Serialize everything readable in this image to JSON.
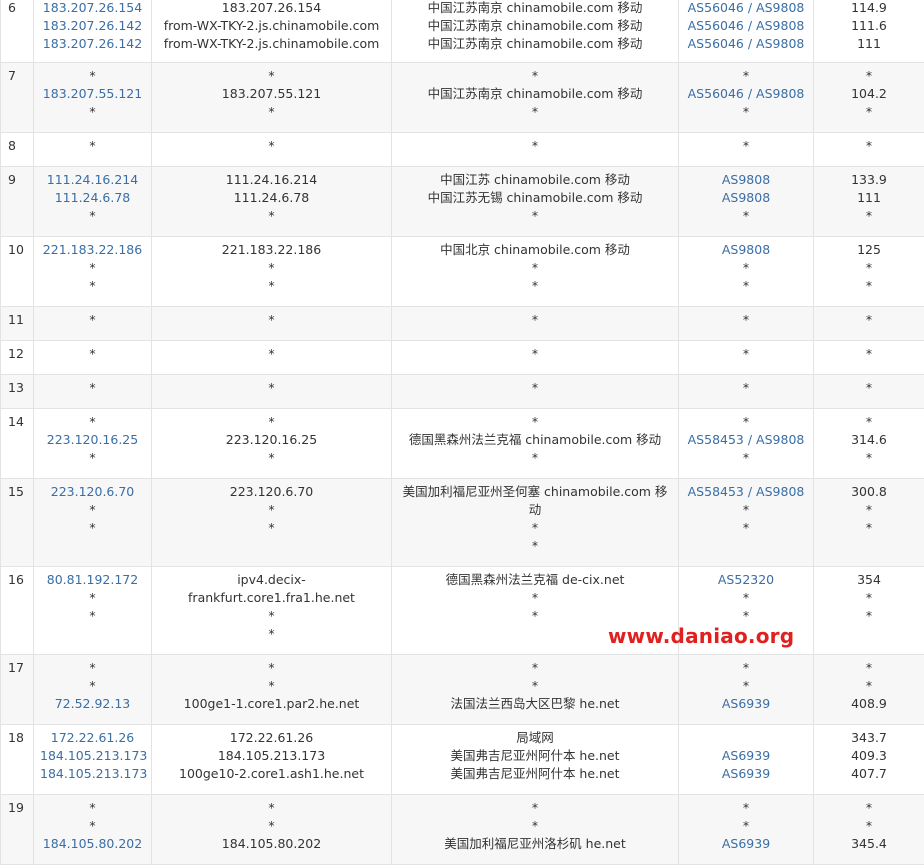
{
  "rows": [
    {
      "hop": "6",
      "h": 68,
      "ip": [
        "183.207.26.154",
        "183.207.26.142",
        "183.207.26.142"
      ],
      "host": [
        "183.207.26.154",
        "from-WX-TKY-2.js.chinamobile.com",
        "from-WX-TKY-2.js.chinamobile.com"
      ],
      "loc": [
        "中国江苏南京 chinamobile.com 移动",
        "中国江苏南京 chinamobile.com 移动",
        "中国江苏南京 chinamobile.com 移动"
      ],
      "asn": [
        "AS56046 / AS9808",
        "AS56046 / AS9808",
        "AS56046 / AS9808"
      ],
      "rtt": [
        "114.9",
        "111.6",
        "111"
      ]
    },
    {
      "hop": "7",
      "h": 70,
      "ip": [
        "*",
        "183.207.55.121",
        "*"
      ],
      "host": [
        "*",
        "183.207.55.121",
        "*"
      ],
      "loc": [
        "*",
        "中国江苏南京 chinamobile.com 移动",
        "*"
      ],
      "asn": [
        "*",
        "AS56046 / AS9808",
        "*"
      ],
      "rtt": [
        "*",
        "104.2",
        "*"
      ]
    },
    {
      "hop": "8",
      "h": 34,
      "ip": [
        "*"
      ],
      "host": [
        "*"
      ],
      "loc": [
        "*"
      ],
      "asn": [
        "*"
      ],
      "rtt": [
        "*"
      ]
    },
    {
      "hop": "9",
      "h": 70,
      "ip": [
        "111.24.16.214",
        "111.24.6.78",
        "*"
      ],
      "host": [
        "111.24.16.214",
        "111.24.6.78",
        "*"
      ],
      "loc": [
        "中国江苏 chinamobile.com 移动",
        "中国江苏无锡 chinamobile.com 移动",
        "*"
      ],
      "asn": [
        "AS9808",
        "AS9808",
        "*"
      ],
      "rtt": [
        "133.9",
        "111",
        "*"
      ]
    },
    {
      "hop": "10",
      "h": 70,
      "ip": [
        "221.183.22.186",
        "*",
        "*"
      ],
      "host": [
        "221.183.22.186",
        "*",
        "*"
      ],
      "loc": [
        "中国北京 chinamobile.com 移动",
        "*",
        "*"
      ],
      "asn": [
        "AS9808",
        "*",
        "*"
      ],
      "rtt": [
        "125",
        "*",
        "*"
      ]
    },
    {
      "hop": "11",
      "h": 34,
      "ip": [
        "*"
      ],
      "host": [
        "*"
      ],
      "loc": [
        "*"
      ],
      "asn": [
        "*"
      ],
      "rtt": [
        "*"
      ]
    },
    {
      "hop": "12",
      "h": 34,
      "ip": [
        "*"
      ],
      "host": [
        "*"
      ],
      "loc": [
        "*"
      ],
      "asn": [
        "*"
      ],
      "rtt": [
        "*"
      ]
    },
    {
      "hop": "13",
      "h": 34,
      "ip": [
        "*"
      ],
      "host": [
        "*"
      ],
      "loc": [
        "*"
      ],
      "asn": [
        "*"
      ],
      "rtt": [
        "*"
      ]
    },
    {
      "hop": "14",
      "h": 70,
      "ip": [
        "*",
        "223.120.16.25",
        "*"
      ],
      "host": [
        "*",
        "223.120.16.25",
        "*"
      ],
      "loc": [
        "*",
        "德国黑森州法兰克福 chinamobile.com 移动",
        "*"
      ],
      "asn": [
        "*",
        "AS58453 / AS9808",
        "*"
      ],
      "rtt": [
        "*",
        "314.6",
        "*"
      ]
    },
    {
      "hop": "15",
      "h": 88,
      "ip": [
        "223.120.6.70",
        "*",
        "*"
      ],
      "host": [
        "223.120.6.70",
        "*",
        "*"
      ],
      "loc": [
        "美国加利福尼亚州圣何塞 chinamobile.com 移动",
        "*",
        "*"
      ],
      "asn": [
        "AS58453 / AS9808",
        "*",
        "*"
      ],
      "rtt": [
        "300.8",
        "*",
        "*"
      ]
    },
    {
      "hop": "16",
      "h": 88,
      "ip": [
        "80.81.192.172",
        "*",
        "*"
      ],
      "host": [
        "ipv4.decix-frankfurt.core1.fra1.he.net",
        "*",
        "*"
      ],
      "loc": [
        "德国黑森州法兰克福 de-cix.net",
        "*",
        "*"
      ],
      "asn": [
        "AS52320",
        "*",
        "*"
      ],
      "rtt": [
        "354",
        "*",
        "*"
      ]
    },
    {
      "hop": "17",
      "h": 70,
      "ip": [
        "*",
        "*",
        "72.52.92.13"
      ],
      "host": [
        "*",
        "*",
        "100ge1-1.core1.par2.he.net"
      ],
      "loc": [
        "*",
        "*",
        "法国法兰西岛大区巴黎 he.net"
      ],
      "asn": [
        "*",
        "*",
        "AS6939"
      ],
      "rtt": [
        "*",
        "*",
        "408.9"
      ]
    },
    {
      "hop": "18",
      "h": 70,
      "ip": [
        "172.22.61.26",
        "184.105.213.173",
        "184.105.213.173"
      ],
      "host": [
        "172.22.61.26",
        "184.105.213.173",
        "100ge10-2.core1.ash1.he.net"
      ],
      "loc": [
        "局域网",
        "美国弗吉尼亚州阿什本 he.net",
        "美国弗吉尼亚州阿什本 he.net"
      ],
      "asn": [
        "",
        "AS6939",
        "AS6939"
      ],
      "rtt": [
        "343.7",
        "409.3",
        "407.7"
      ]
    },
    {
      "hop": "19",
      "h": 70,
      "ip": [
        "*",
        "*",
        "184.105.80.202"
      ],
      "host": [
        "*",
        "*",
        "184.105.80.202"
      ],
      "loc": [
        "*",
        "*",
        "美国加利福尼亚州洛杉矶 he.net"
      ],
      "asn": [
        "*",
        "*",
        "AS6939"
      ],
      "rtt": [
        "*",
        "*",
        "345.4"
      ]
    }
  ],
  "watermark": "www.daniao.org"
}
